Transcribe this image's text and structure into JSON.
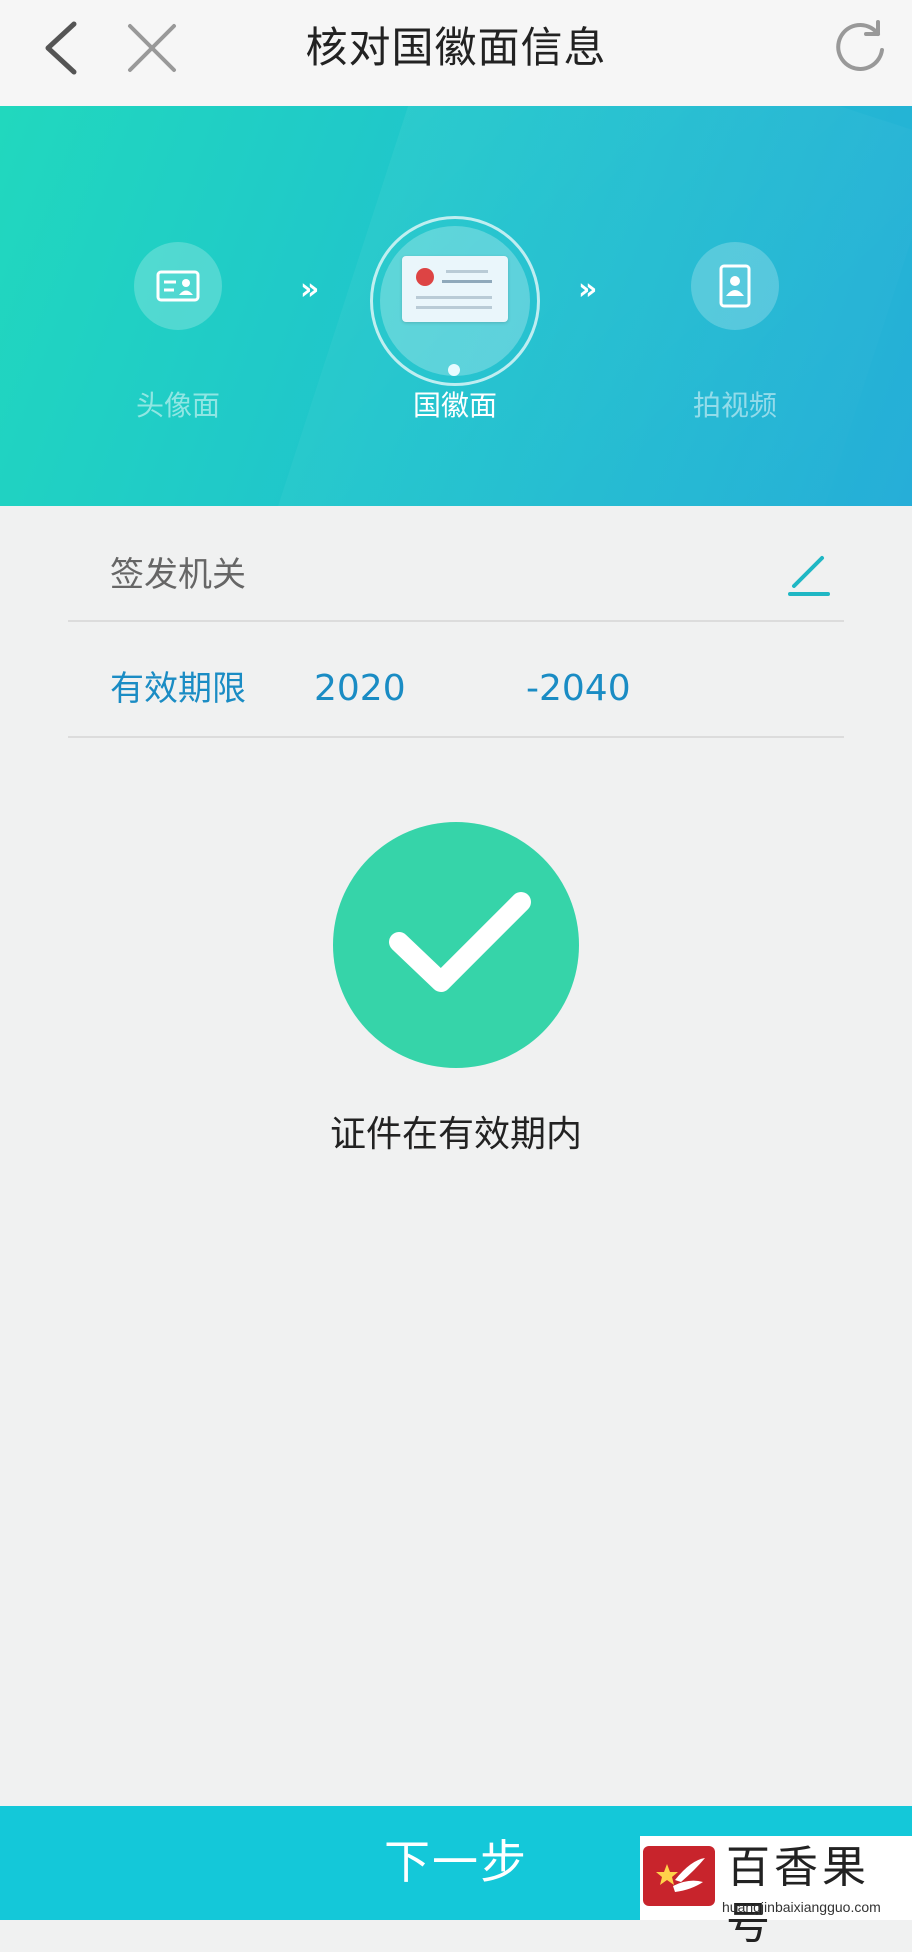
{
  "header": {
    "title": "核对国徽面信息",
    "back_icon": "chevron-left-icon",
    "close_icon": "close-icon",
    "refresh_icon": "refresh-icon"
  },
  "steps": [
    {
      "label": "头像面",
      "state": "inactive",
      "icon": "portrait-card-icon"
    },
    {
      "label": "国徽面",
      "state": "active",
      "icon": "id-card-emblem-icon"
    },
    {
      "label": "拍视频",
      "state": "inactive",
      "icon": "video-portrait-icon"
    }
  ],
  "step_separator": "»",
  "fields": {
    "authority_label": "签发机关",
    "authority_value": "",
    "validity_label": "有效期限",
    "validity_start": "2020",
    "validity_end": "-2040"
  },
  "status": {
    "text": "证件在有效期内",
    "color": "#36d4a9"
  },
  "footer": {
    "next_label": "下一步",
    "color": "#14c8d9"
  },
  "watermark": {
    "title": "百香果号",
    "url": "huangjinbaixiangguo.com"
  },
  "colors": {
    "accent": "#1a8cc4",
    "hero_start": "#21d8be",
    "hero_end": "#26aed8"
  }
}
